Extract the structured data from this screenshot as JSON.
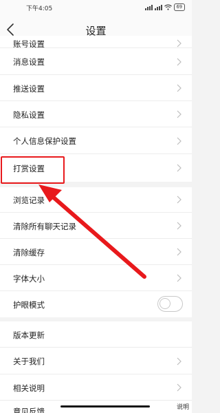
{
  "status_bar": {
    "time": "下午4:05",
    "battery": "69"
  },
  "header": {
    "title": "设置"
  },
  "settings": {
    "items": [
      {
        "label": "账号设置"
      },
      {
        "label": "消息设置"
      },
      {
        "label": "推送设置"
      },
      {
        "label": "隐私设置"
      },
      {
        "label": "个人信息保护设置"
      },
      {
        "label": "打赏设置"
      },
      {
        "label": "浏览记录"
      },
      {
        "label": "清除所有聊天记录"
      },
      {
        "label": "清除缓存"
      },
      {
        "label": "字体大小"
      },
      {
        "label": "护眼模式",
        "toggle_on": false
      },
      {
        "label": "版本更新"
      },
      {
        "label": "关于我们"
      },
      {
        "label": "相关说明"
      },
      {
        "label": "意见反馈"
      }
    ]
  },
  "corner_fragment": "说明",
  "annotation_color": "#e8191c"
}
